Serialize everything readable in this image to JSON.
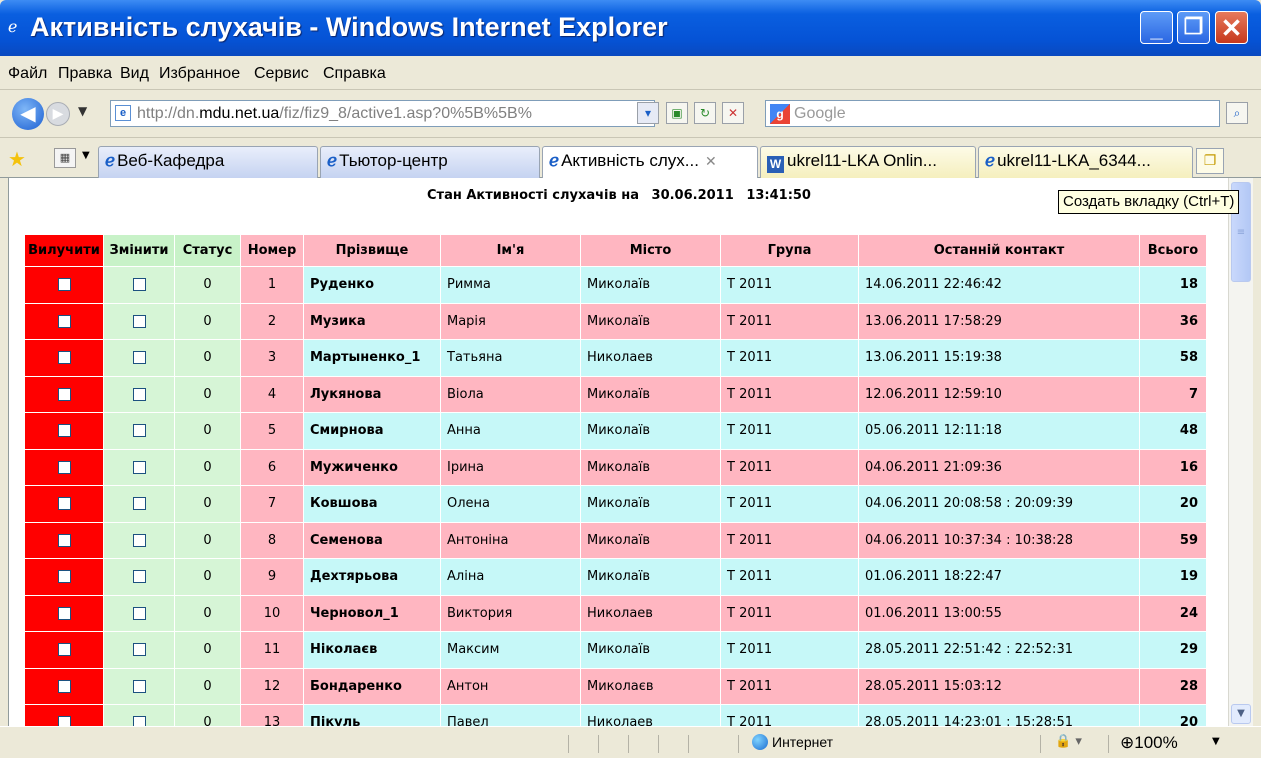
{
  "window": {
    "title": "Активність слухачів - Windows Internet Explorer",
    "title_icon": "ie-icon",
    "controls": {
      "minimize": "_",
      "maximize": "❐",
      "close": "✕"
    }
  },
  "menu": [
    "Файл",
    "Правка",
    "Вид",
    "Избранное",
    "Сервис",
    "Справка"
  ],
  "address": {
    "prefix": "http://dn.",
    "domain": "mdu.net.ua",
    "path": "/fiz/fiz9_8/active1.asp?0%5B%5B%",
    "search_placeholder": "Google"
  },
  "tabs": [
    {
      "label": "Веб-Кафедра",
      "icon": "ie-icon"
    },
    {
      "label": "Тьютор-центр",
      "icon": "ie-icon"
    },
    {
      "label": "Активність слух...",
      "icon": "ie-icon",
      "active": true
    },
    {
      "label": "ukrel11-LKA Onlin...",
      "icon": "word-icon"
    },
    {
      "label": "ukrel11-LKA_6344...",
      "icon": "ie-icon"
    }
  ],
  "tooltip": "Создать вкладку (Ctrl+T)",
  "page": {
    "heading_label": "Стан Активності слухачів на",
    "heading_date": "30.06.2011",
    "heading_time": "13:41:50"
  },
  "table": {
    "headers": [
      "Вилучити",
      "Змінити",
      "Статус",
      "Номер",
      "Прізвище",
      "Ім'я",
      "Місто",
      "Група",
      "Останній контакт",
      "Всього"
    ],
    "rows": [
      {
        "status": "0",
        "num": "1",
        "surname": "Руденко",
        "name": "Римма",
        "city": "Миколаїв",
        "group": "Т 2011",
        "last": "14.06.2011 22:46:42",
        "total": "18"
      },
      {
        "status": "0",
        "num": "2",
        "surname": "Музика",
        "name": "Марія",
        "city": "Миколаїв",
        "group": "Т 2011",
        "last": "13.06.2011 17:58:29",
        "total": "36"
      },
      {
        "status": "0",
        "num": "3",
        "surname": "Мартыненко_1",
        "name": "Татьяна",
        "city": "Николаев",
        "group": "Т 2011",
        "last": "13.06.2011 15:19:38",
        "total": "58"
      },
      {
        "status": "0",
        "num": "4",
        "surname": "Лукянова",
        "name": "Віола",
        "city": "Миколаїв",
        "group": "Т 2011",
        "last": "12.06.2011 12:59:10",
        "total": "7"
      },
      {
        "status": "0",
        "num": "5",
        "surname": "Смирнова",
        "name": "Анна",
        "city": "Миколаїв",
        "group": "Т 2011",
        "last": "05.06.2011 12:11:18",
        "total": "48"
      },
      {
        "status": "0",
        "num": "6",
        "surname": "Мужиченко",
        "name": "Ірина",
        "city": "Миколаїв",
        "group": "Т 2011",
        "last": "04.06.2011 21:09:36",
        "total": "16"
      },
      {
        "status": "0",
        "num": "7",
        "surname": "Ковшова",
        "name": "Олена",
        "city": "Миколаїв",
        "group": "Т 2011",
        "last": "04.06.2011 20:08:58 : 20:09:39",
        "total": "20"
      },
      {
        "status": "0",
        "num": "8",
        "surname": "Семенова",
        "name": "Антоніна",
        "city": "Миколаїв",
        "group": "Т 2011",
        "last": "04.06.2011 10:37:34 : 10:38:28",
        "total": "59"
      },
      {
        "status": "0",
        "num": "9",
        "surname": "Дехтярьова",
        "name": "Аліна",
        "city": "Миколаїв",
        "group": "Т 2011",
        "last": "01.06.2011 18:22:47",
        "total": "19"
      },
      {
        "status": "0",
        "num": "10",
        "surname": "Черновол_1",
        "name": "Виктория",
        "city": "Николаев",
        "group": "Т 2011",
        "last": "01.06.2011 13:00:55",
        "total": "24"
      },
      {
        "status": "0",
        "num": "11",
        "surname": "Ніколаєв",
        "name": "Максим",
        "city": "Миколаїв",
        "group": "Т 2011",
        "last": "28.05.2011 22:51:42 : 22:52:31",
        "total": "29"
      },
      {
        "status": "0",
        "num": "12",
        "surname": "Бондаренко",
        "name": "Антон",
        "city": "Миколаєв",
        "group": "Т 2011",
        "last": "28.05.2011 15:03:12",
        "total": "28"
      },
      {
        "status": "0",
        "num": "13",
        "surname": "Пікуль",
        "name": "Павел",
        "city": "Николаев",
        "group": "Т 2011",
        "last": "28.05.2011 14:23:01 : 15:28:51",
        "total": "20"
      }
    ]
  },
  "status": {
    "zone": "Интернет",
    "zoom": "100%"
  },
  "colors": {
    "delete_col": "#ff0000",
    "green_col": "#d6f5d6",
    "pink_row": "#ffb6c1",
    "cyan_row": "#c6f8f8"
  }
}
